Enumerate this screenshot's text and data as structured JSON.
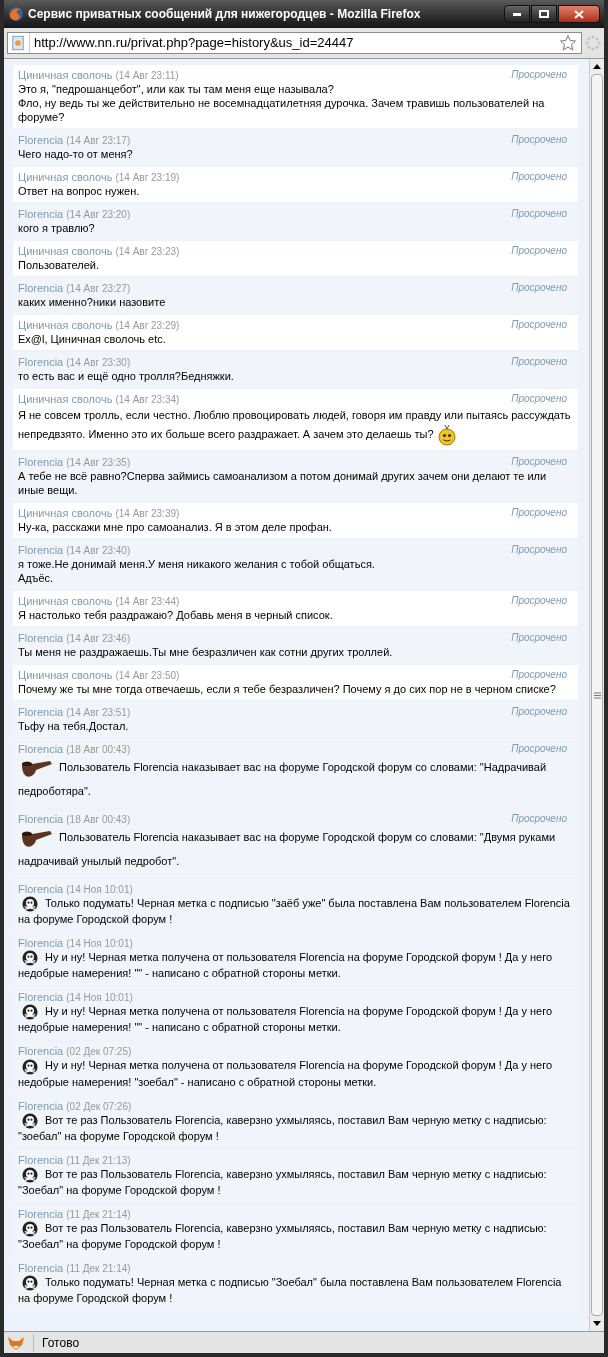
{
  "window": {
    "title": "Сервис приватных сообщений для нижегородцев - Mozilla Firefox"
  },
  "address_bar": {
    "url": "http://www.nn.ru/privat.php?page=history&us_id=24447"
  },
  "messages": [
    {
      "author": "Циничная сволочь",
      "time": "(14 Авг 23:11)",
      "status": "Просрочено",
      "incoming": false,
      "kind": "text",
      "text": "Это я, \"педрошанцебот\", или как ты там меня еще называла?\nФло, ну ведь ты же действительно не восемнадцатилетняя дурочка. Зачем травишь пользователей на форуме?"
    },
    {
      "author": "Florencia",
      "time": "(14 Авг 23:17)",
      "status": "Просрочено",
      "incoming": true,
      "kind": "text",
      "text": "Чего надо-то от меня?"
    },
    {
      "author": "Циничная сволочь",
      "time": "(14 Авг 23:19)",
      "status": "Просрочено",
      "incoming": false,
      "kind": "text",
      "text": "Ответ на вопрос нужен."
    },
    {
      "author": "Florencia",
      "time": "(14 Авг 23:20)",
      "status": "Просрочено",
      "incoming": true,
      "kind": "text",
      "text": "кого я травлю?"
    },
    {
      "author": "Циничная сволочь",
      "time": "(14 Авг 23:23)",
      "status": "Просрочено",
      "incoming": false,
      "kind": "text",
      "text": "Пользователей."
    },
    {
      "author": "Florencia",
      "time": "(14 Авг 23:27)",
      "status": "Просрочено",
      "incoming": true,
      "kind": "text",
      "text": "каких именно?ники назовите"
    },
    {
      "author": "Циничная сволочь",
      "time": "(14 Авг 23:29)",
      "status": "Просрочено",
      "incoming": false,
      "kind": "text",
      "text": "Ex@l, Циничная сволочь etc."
    },
    {
      "author": "Florencia",
      "time": "(14 Авг 23:30)",
      "status": "Просрочено",
      "incoming": true,
      "kind": "text",
      "text": "то есть вас и ещё одно тролля?Бедняжки."
    },
    {
      "author": "Циничная сволочь",
      "time": "(14 Авг 23:34)",
      "status": "Просрочено",
      "incoming": false,
      "kind": "text",
      "smiley": true,
      "text": "Я не совсем тролль, если честно. Люблю провоцировать людей, говоря им правду или пытаясь рассуждать непредвзято. Именно это их больше всего раздражает. А зачем это делаешь ты?"
    },
    {
      "author": "Florencia",
      "time": "(14 Авг 23:35)",
      "status": "Просрочено",
      "incoming": true,
      "kind": "text",
      "text": "А тебе не всё равно?Сперва займись самоанализом а потом донимай других зачем они делают те или иные вещи."
    },
    {
      "author": "Циничная сволочь",
      "time": "(14 Авг 23:39)",
      "status": "Просрочено",
      "incoming": false,
      "kind": "text",
      "text": "Ну-ка, расскажи мне про самоанализ. Я в этом деле профан."
    },
    {
      "author": "Florencia",
      "time": "(14 Авг 23:40)",
      "status": "Просрочено",
      "incoming": true,
      "kind": "text",
      "text": "я тоже.Не донимай меня.У меня никакого желания с тобой общаться.\nАдъёс."
    },
    {
      "author": "Циничная сволочь",
      "time": "(14 Авг 23:44)",
      "status": "Просрочено",
      "incoming": false,
      "kind": "text",
      "text": "Я настолько тебя раздражаю? Добавь меня в черный список."
    },
    {
      "author": "Florencia",
      "time": "(14 Авг 23:46)",
      "status": "Просрочено",
      "incoming": true,
      "kind": "text",
      "text": "Ты меня не раздражаешь.Ты мне безразличен как сотни других троллей."
    },
    {
      "author": "Циничная сволочь",
      "time": "(14 Авг 23:50)",
      "status": "Просрочено",
      "incoming": false,
      "kind": "text",
      "text": "Почему же ты мне тогда отвечаешь, если я тебе безразличен? Почему я до сих пор не в черном списке?"
    },
    {
      "author": "Florencia",
      "time": "(14 Авг 23:51)",
      "status": "Просрочено",
      "incoming": true,
      "kind": "text",
      "text": "Тьфу на тебя.Достал."
    },
    {
      "author": "Florencia",
      "time": "(18 Авг 00:43)",
      "status": "Просрочено",
      "incoming": true,
      "kind": "punish",
      "text": "Пользователь Florencia наказывает вас на форуме Городской форум со словами: \"Надрачивай педроботяра\"."
    },
    {
      "author": "Florencia",
      "time": "(18 Авг 00:43)",
      "status": "Просрочено",
      "incoming": true,
      "kind": "punish",
      "text": "Пользователь Florencia наказывает вас на форуме Городской форум со словами: \"Двумя руками надрачивай унылый педробот\"."
    },
    {
      "author": "Florencia",
      "time": "(14 Ноя 10:01)",
      "incoming": true,
      "kind": "mark",
      "text": "Только подумать! Черная метка с подписью \"заёб уже\" была поставлена Вам пользователем Florencia на форуме Городской форум !"
    },
    {
      "author": "Florencia",
      "time": "(14 Ноя 10:01)",
      "incoming": true,
      "kind": "mark",
      "text": "Ну и ну! Черная метка получена от пользователя Florencia на форуме Городской форум ! Да у него недобрые намерения! \"\" - написано с обратной стороны метки."
    },
    {
      "author": "Florencia",
      "time": "(14 Ноя 10:01)",
      "incoming": true,
      "kind": "mark",
      "text": "Ну и ну! Черная метка получена от пользователя Florencia на форуме Городской форум ! Да у него недобрые намерения! \"\" - написано с обратной стороны метки."
    },
    {
      "author": "Florencia",
      "time": "(02 Дек 07:25)",
      "incoming": true,
      "kind": "mark",
      "text": "Ну и ну! Черная метка получена от пользователя Florencia на форуме Городской форум ! Да у него недобрые намерения! \"зоебал\" - написано с обратной стороны метки."
    },
    {
      "author": "Florencia",
      "time": "(02 Дек 07:26)",
      "incoming": true,
      "kind": "mark",
      "text": "Вот те раз Пользователь Florencia, каверзно ухмыляясь, поставил Вам черную метку с надписью: \"зоебал\" на форуме Городской форум !"
    },
    {
      "author": "Florencia",
      "time": "(11 Дек 21:13)",
      "incoming": true,
      "kind": "mark",
      "text": "Вот те раз Пользователь Florencia, каверзно ухмыляясь, поставил Вам черную метку с надписью: \"Зоебал\" на форуме Городской форум !"
    },
    {
      "author": "Florencia",
      "time": "(11 Дек 21:14)",
      "incoming": true,
      "kind": "mark",
      "text": "Вот те раз Пользователь Florencia, каверзно ухмыляясь, поставил Вам черную метку с надписью: \"Зоебал\" на форуме Городской форум !"
    },
    {
      "author": "Florencia",
      "time": "(11 Дек 21:14)",
      "incoming": true,
      "kind": "mark",
      "text": "Только подумать! Черная метка с подписью \"Зоебал\" была поставлена Вам пользователем Florencia на форуме Городской форум !"
    }
  ],
  "status_bar": {
    "text": "Готово"
  }
}
